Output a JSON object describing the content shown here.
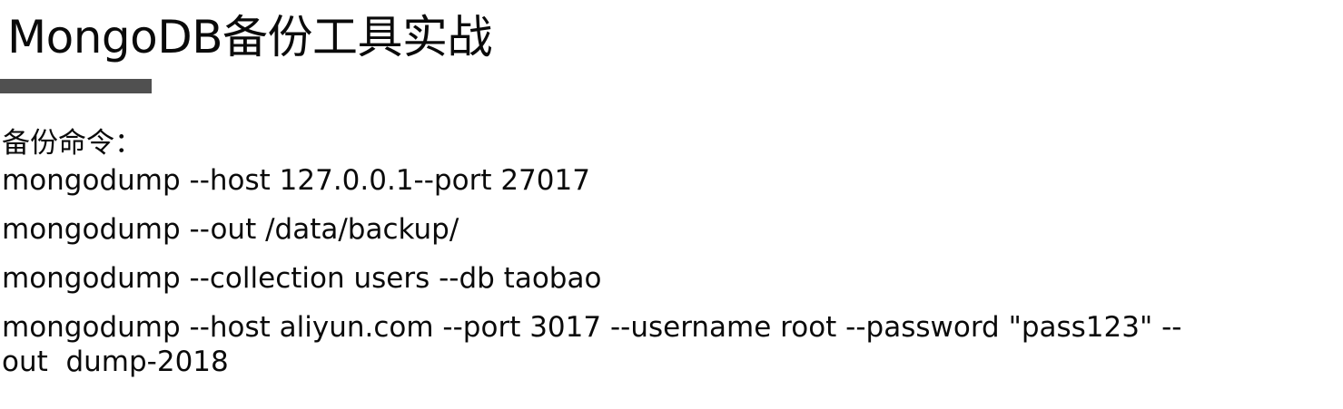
{
  "slide": {
    "title": "MongoDB备份工具实战",
    "accent_color": "#505050",
    "section_label": "备份命令：",
    "commands": [
      "mongodump --host 127.0.0.1--port 27017",
      "mongodump --out /data/backup/",
      "mongodump --collection users --db taobao",
      "mongodump --host aliyun.com --port 3017 --username root --password \"pass123\" --\nout  dump-2018"
    ]
  }
}
